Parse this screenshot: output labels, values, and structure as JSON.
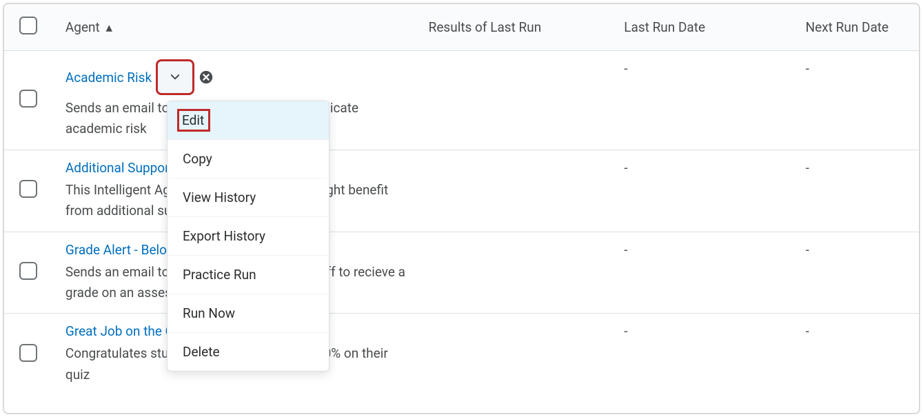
{
  "columns": {
    "agent": "Agent",
    "results": "Results of Last Run",
    "last": "Last Run Date",
    "next": "Next Run Date"
  },
  "sort_glyph": "▴",
  "rows": [
    {
      "title": "Academic Risk",
      "desc": "Sends an email to the student's Advisor to indicate academic risk",
      "results": "",
      "last": "-",
      "next": "-",
      "show_chevron": true,
      "disabled": true
    },
    {
      "title": "Additional Support",
      "desc": "This Intelligent Agent identifies users who might benefit from additional support.",
      "results": "",
      "last": "-",
      "next": "-"
    },
    {
      "title": "Grade Alert - Below 80%",
      "desc": "Sends an email to students that have fallen off to recieve a grade on an assessment that is below 80%",
      "results": "",
      "last": "-",
      "next": "-"
    },
    {
      "title": "Great Job on the Quiz",
      "desc": "Congratulates students on receiving above 80% on their quiz",
      "results": "",
      "last": "-",
      "next": "-"
    }
  ],
  "menu": {
    "items": [
      "Edit",
      "Copy",
      "View History",
      "Export History",
      "Practice Run",
      "Run Now",
      "Delete"
    ],
    "active_index": 0
  }
}
